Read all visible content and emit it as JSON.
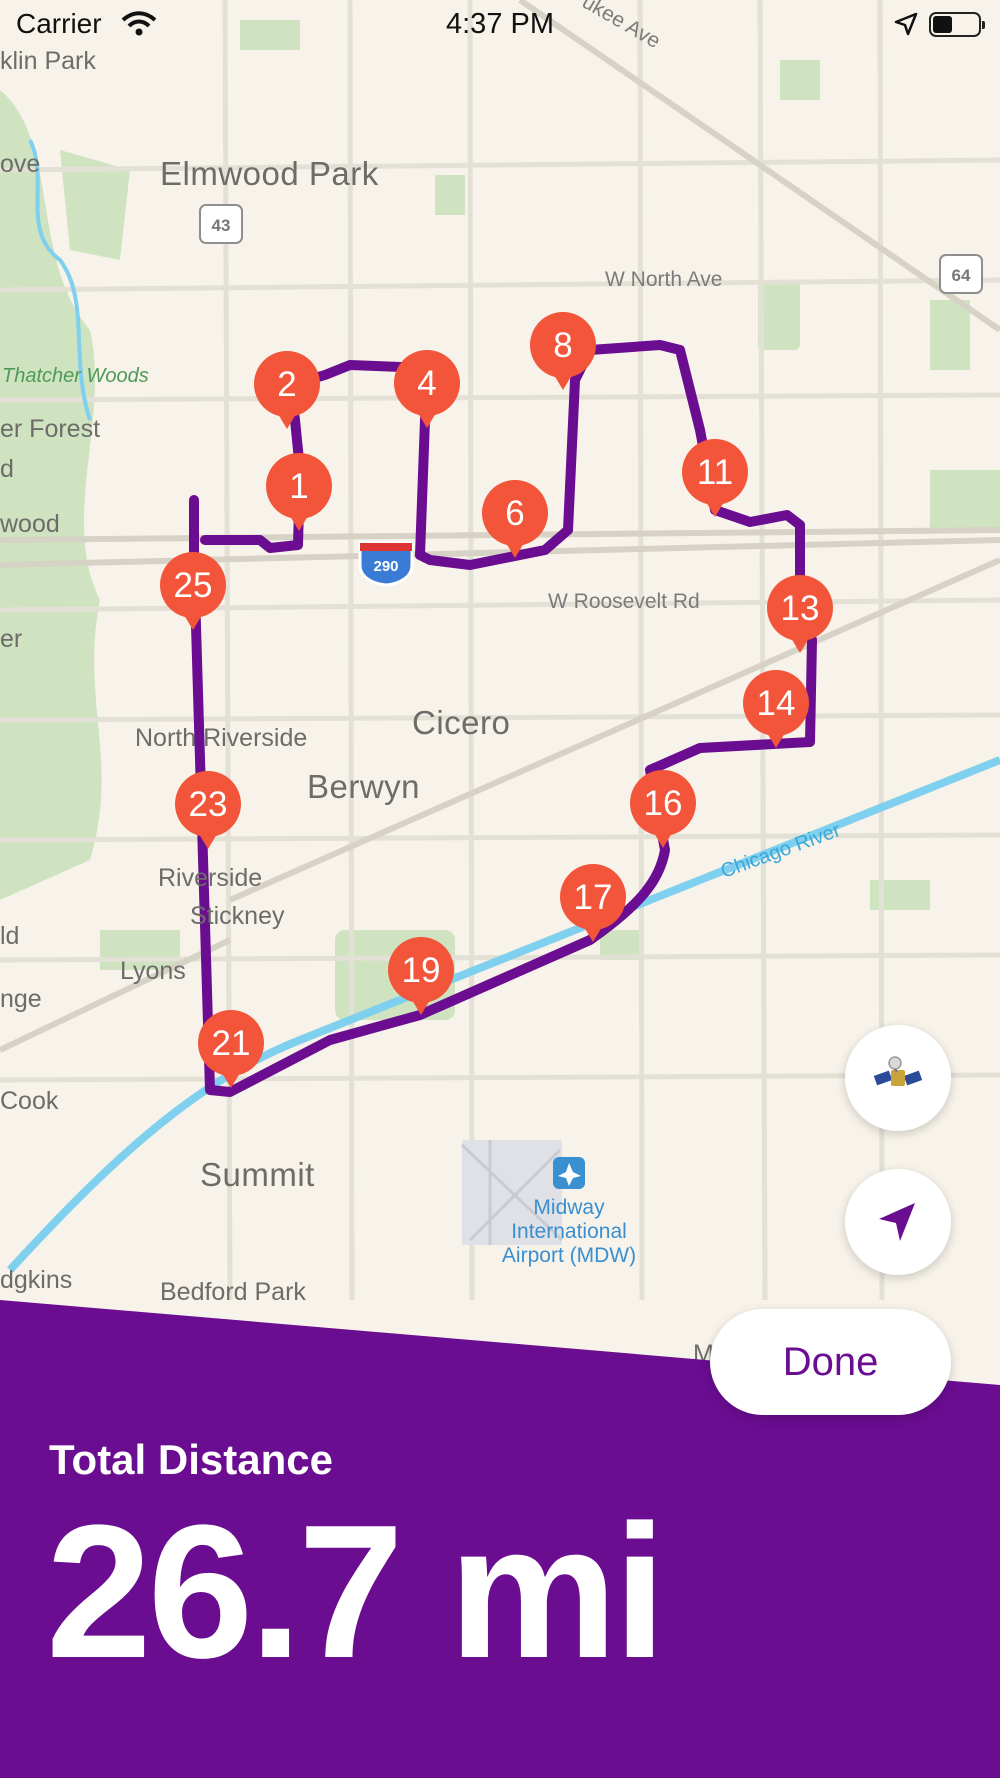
{
  "status_bar": {
    "carrier": "Carrier",
    "time": "4:37 PM"
  },
  "map": {
    "place_labels": [
      "klin Park",
      "ove",
      "Elmwood Park",
      "er Forest",
      "d",
      "wood",
      "er",
      "North Riverside",
      "Cicero",
      "Berwyn",
      "Riverside",
      "Stickney",
      "ld",
      "Lyons",
      "nge",
      "Cook",
      "Summit",
      "dgkins",
      "Bedford Park",
      "M"
    ],
    "road_labels": [
      "W North Ave",
      "W Roosevelt Rd",
      "ukee Ave"
    ],
    "park_labels": [
      "Thatcher Woods"
    ],
    "water_labels": [
      "Chicago River"
    ],
    "shields": [
      "43",
      "64",
      "290"
    ],
    "airport": {
      "name": "Midway International Airport (MDW)",
      "icon": "airplane-icon"
    },
    "route_color": "#6a0d91",
    "pin_color": "#f2553a",
    "waypoints": [
      "1",
      "2",
      "4",
      "6",
      "8",
      "11",
      "13",
      "14",
      "16",
      "17",
      "19",
      "21",
      "23",
      "25"
    ]
  },
  "controls": {
    "satellite_icon": "satellite-icon",
    "locate_icon": "location-arrow-icon",
    "done_label": "Done"
  },
  "summary": {
    "label": "Total Distance",
    "value": "26.7 mi",
    "background": "#6a0d91"
  }
}
